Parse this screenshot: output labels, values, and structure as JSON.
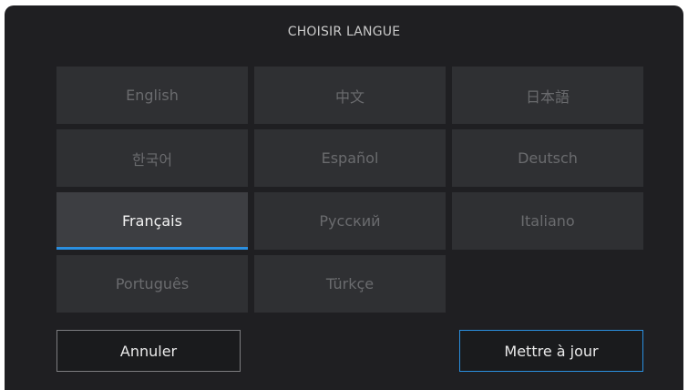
{
  "dialog": {
    "title": "CHOISIR LANGUE"
  },
  "languages": [
    {
      "label": "English",
      "selected": false
    },
    {
      "label": "中文",
      "selected": false
    },
    {
      "label": "日本語",
      "selected": false
    },
    {
      "label": "한국어",
      "selected": false
    },
    {
      "label": "Español",
      "selected": false
    },
    {
      "label": "Deutsch",
      "selected": false
    },
    {
      "label": "Français",
      "selected": true
    },
    {
      "label": "Русский",
      "selected": false
    },
    {
      "label": "Italiano",
      "selected": false
    },
    {
      "label": "Português",
      "selected": false
    },
    {
      "label": "Türkçe",
      "selected": false
    }
  ],
  "buttons": {
    "cancel_label": "Annuler",
    "update_label": "Mettre à jour"
  },
  "colors": {
    "accent": "#2a8fe0",
    "panel": "#1f1f22",
    "tile": "#2f3033",
    "tile_selected": "#3d3e42"
  }
}
